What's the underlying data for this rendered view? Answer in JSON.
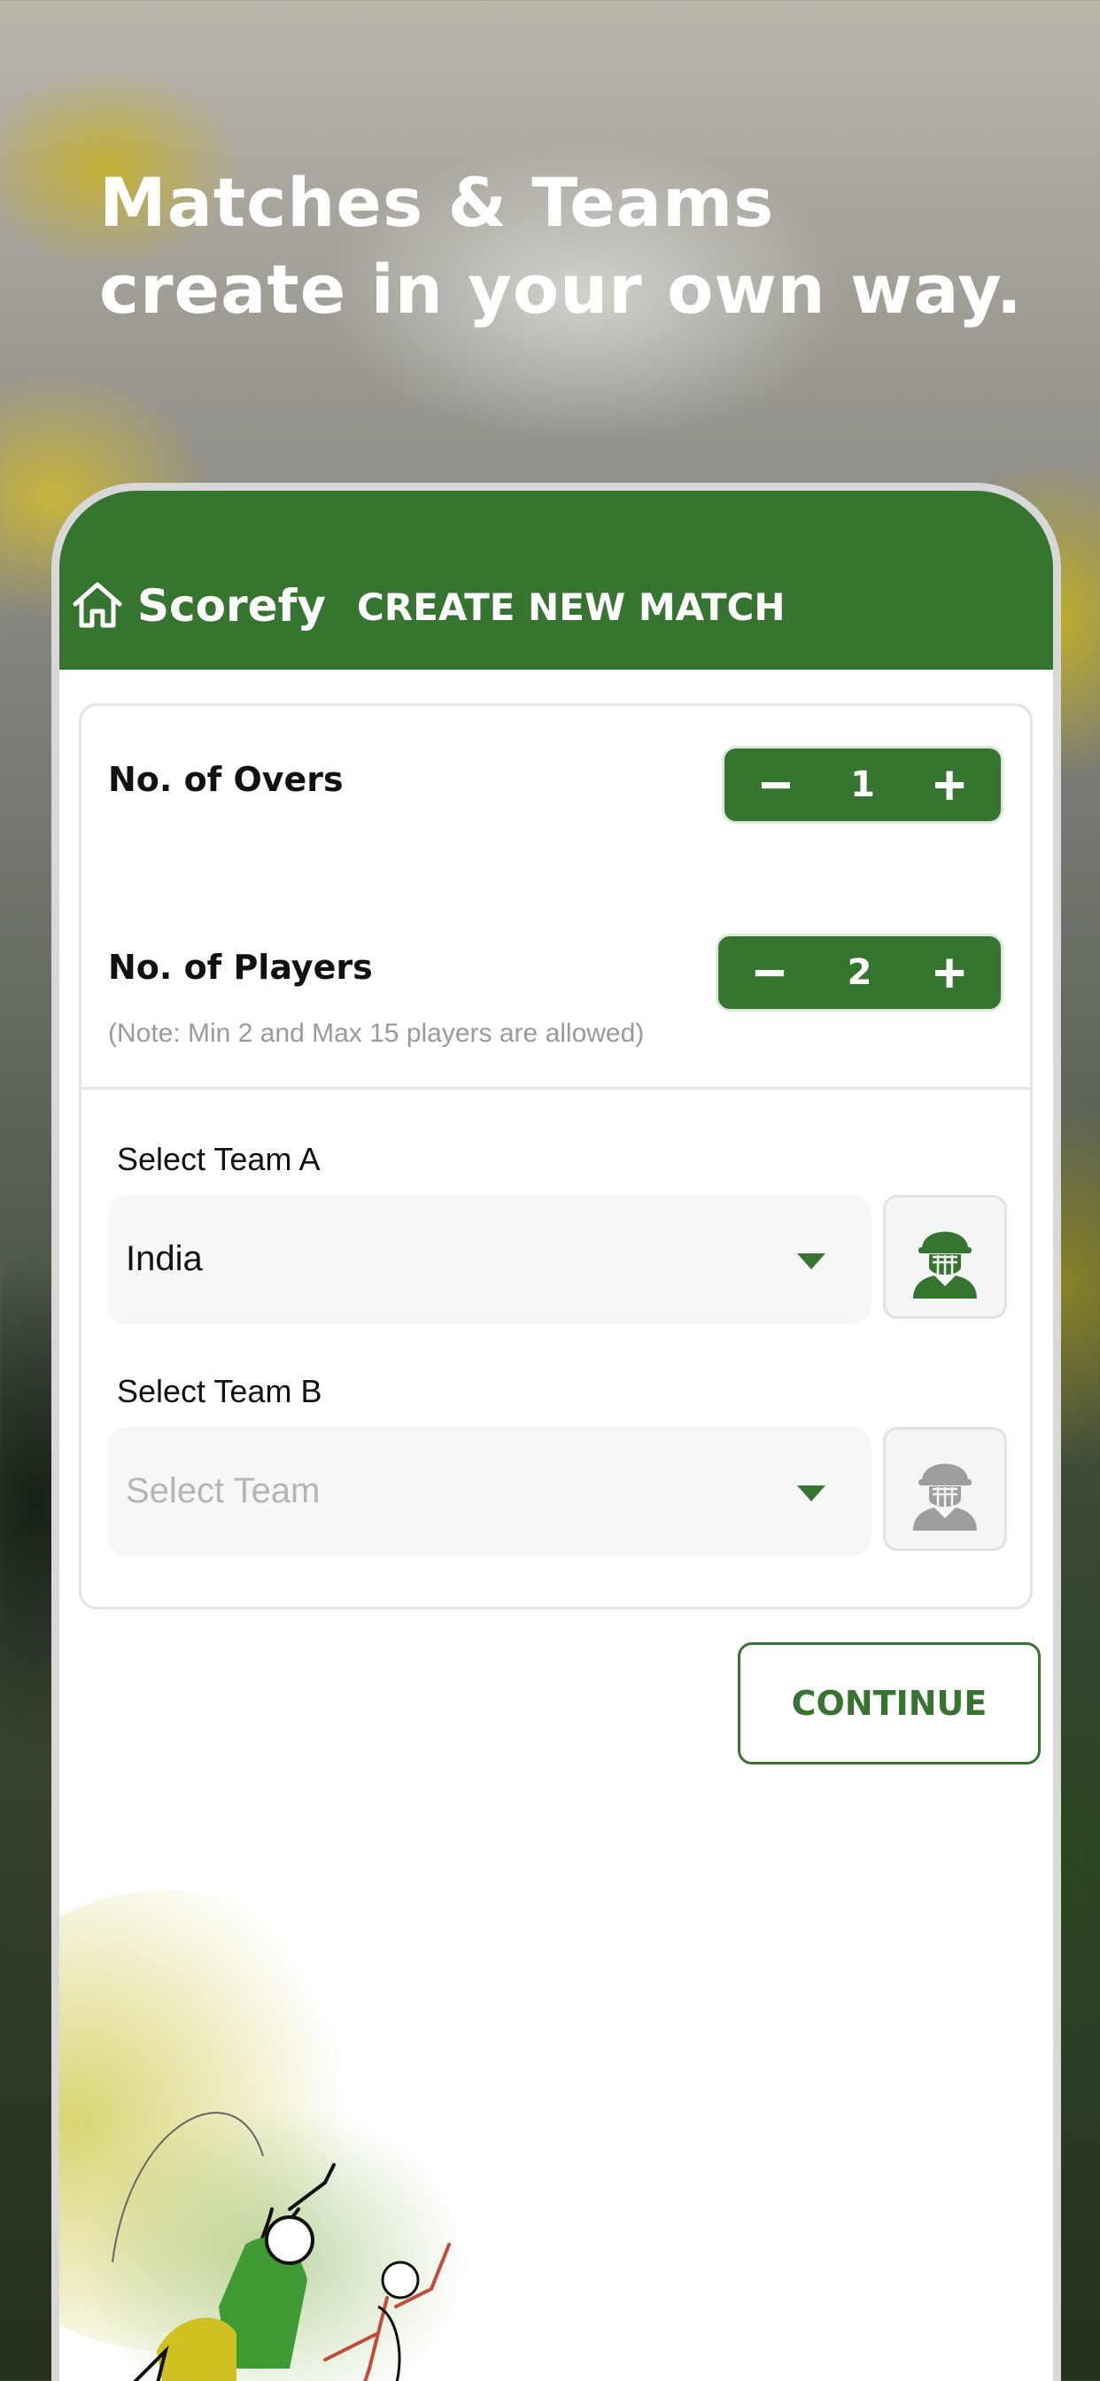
{
  "headline": {
    "line1": "Matches & Teams",
    "line2": "create in your own way."
  },
  "appbar": {
    "home_icon": "home-icon",
    "brand": "Scorefy",
    "title": "CREATE NEW MATCH"
  },
  "overs": {
    "label": "No. of Overs",
    "value": "1",
    "minus": "−",
    "plus": "+"
  },
  "players": {
    "label": "No. of Players",
    "value": "2",
    "minus": "−",
    "plus": "+",
    "note": "(Note: Min 2 and Max 15 players are allowed)"
  },
  "team_a": {
    "label": "Select Team A",
    "value": "India",
    "icon": "cricket-player-icon"
  },
  "team_b": {
    "label": "Select Team B",
    "placeholder": "Select Team",
    "icon": "cricket-player-icon"
  },
  "continue_label": "CONTINUE",
  "colors": {
    "primary": "#367530",
    "white": "#ffffff",
    "placeholder": "#b5b5b5"
  }
}
